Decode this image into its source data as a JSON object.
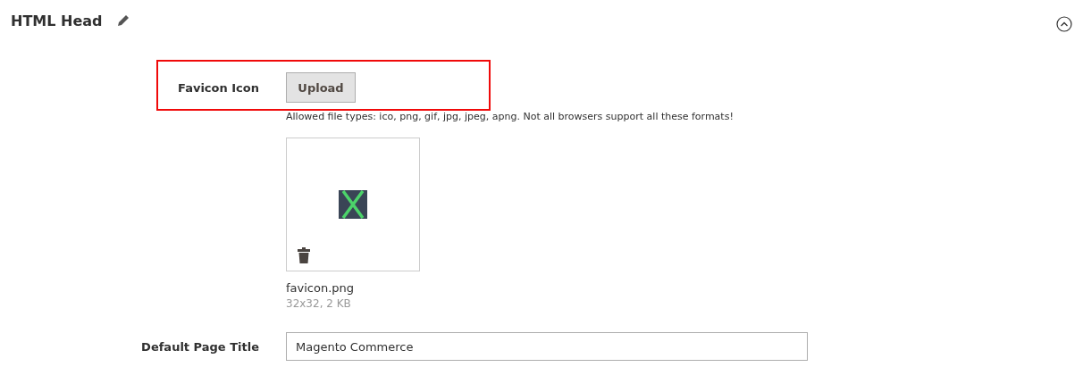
{
  "section": {
    "title": "HTML Head",
    "expanded": true
  },
  "favicon": {
    "label": "Favicon Icon",
    "button": "Upload",
    "highlighted": true,
    "note": "Allowed file types: ico, png, gif, jpg, jpeg, apng. Not all browsers support all these formats!",
    "file_name": "favicon.png",
    "file_info": "32x32, 2 KB"
  },
  "page_title": {
    "label": "Default Page Title",
    "value": "Magento Commerce"
  }
}
